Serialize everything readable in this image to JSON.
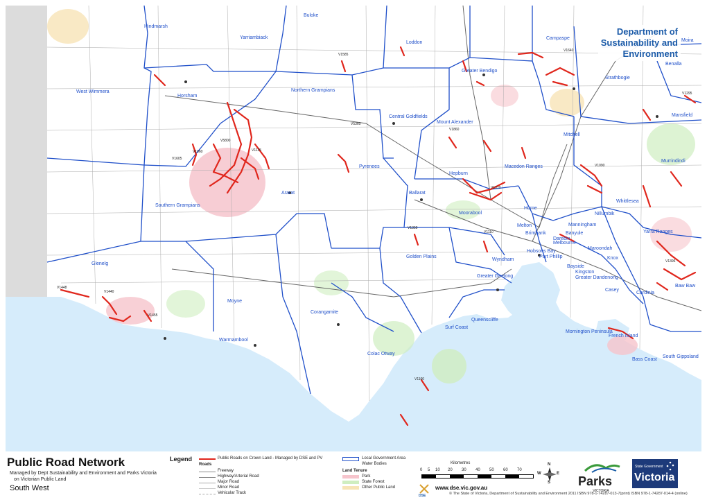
{
  "header": {
    "dept_line1": "Department of",
    "dept_line2": "Sustainability and",
    "dept_line3": "Environment"
  },
  "map": {
    "places": [
      {
        "name": "Buloke"
      },
      {
        "name": "Hindmarsh"
      },
      {
        "name": "Yarriambiack"
      },
      {
        "name": "Loddon"
      },
      {
        "name": "Campaspe"
      },
      {
        "name": "Moira"
      },
      {
        "name": "Greater Bendigo"
      },
      {
        "name": "Strathbogie"
      },
      {
        "name": "West Wimmera"
      },
      {
        "name": "Horsham"
      },
      {
        "name": "Northern Grampians"
      },
      {
        "name": "Central Goldfields"
      },
      {
        "name": "Mount Alexander"
      },
      {
        "name": "Mansfield"
      },
      {
        "name": "Mitchell"
      },
      {
        "name": "Pyrenees"
      },
      {
        "name": "Macedon Ranges"
      },
      {
        "name": "Murrindindi"
      },
      {
        "name": "Hepburn"
      },
      {
        "name": "Ararat"
      },
      {
        "name": "Ballarat"
      },
      {
        "name": "Whittlesea"
      },
      {
        "name": "Southern Grampians"
      },
      {
        "name": "Hume"
      },
      {
        "name": "Nillumbik"
      },
      {
        "name": "Moorabool"
      },
      {
        "name": "Melton"
      },
      {
        "name": "Yarra Ranges"
      },
      {
        "name": "Hobsons Bay"
      },
      {
        "name": "Melbourne"
      },
      {
        "name": "Golden Plains"
      },
      {
        "name": "Wyndham"
      },
      {
        "name": "Glenelg"
      },
      {
        "name": "Greater Geelong"
      },
      {
        "name": "Greater Dandenong"
      },
      {
        "name": "Moyne"
      },
      {
        "name": "Casey"
      },
      {
        "name": "Cardinia"
      },
      {
        "name": "Baw Baw"
      },
      {
        "name": "Corangamite"
      },
      {
        "name": "Queenscliffe"
      },
      {
        "name": "Surf Coast"
      },
      {
        "name": "Mornington Peninsula"
      },
      {
        "name": "French Island"
      },
      {
        "name": "Warrnambool"
      },
      {
        "name": "Colac Otway"
      },
      {
        "name": "Bass Coast"
      },
      {
        "name": "South Gippsland"
      },
      {
        "name": "Benalla"
      },
      {
        "name": "Port Phillip"
      },
      {
        "name": "Bayside"
      },
      {
        "name": "Kingston"
      },
      {
        "name": "Manningham"
      },
      {
        "name": "Knox"
      },
      {
        "name": "Maroondah"
      },
      {
        "name": "Banyule"
      },
      {
        "name": "Darebin"
      },
      {
        "name": "Brimbank"
      }
    ],
    "road_labels": [
      {
        "name": "V1640"
      },
      {
        "name": "V1585"
      },
      {
        "name": "V5800"
      },
      {
        "name": "V1396"
      },
      {
        "name": "V1448"
      },
      {
        "name": "V1440"
      },
      {
        "name": "V1370"
      },
      {
        "name": "V1060"
      },
      {
        "name": "V1135"
      },
      {
        "name": "V1110"
      },
      {
        "name": "V5360"
      },
      {
        "name": "V1090"
      },
      {
        "name": "V1295"
      },
      {
        "name": "V1350"
      },
      {
        "name": "V1860"
      },
      {
        "name": "V1455"
      },
      {
        "name": "V1605"
      },
      {
        "name": "V1100"
      }
    ]
  },
  "footer": {
    "title": "Public Road Network",
    "subtitle1": "Managed by Dept Sustainability and Environment and Parks Victoria",
    "subtitle2": "on Victorian Public Land",
    "region": "South West",
    "legend_title": "Legend",
    "legend_roads_heading": "Roads",
    "legend_items": {
      "crown": "Public Roads on Crown Land - Managed by DSE and PV",
      "freeway": "Freeway",
      "highway": "Highway/Arterial Road",
      "major": "Major Road",
      "minor": "Minor Road",
      "track": "Vehicular Track",
      "lga": "Local Government Area",
      "water": "Water Bodies",
      "tenure_heading": "Land Tenure",
      "park": "Park",
      "forest": "State Forest",
      "other": "Other Public Land"
    },
    "scale_title": "Kilometres",
    "scale_ticks": [
      "0",
      "5",
      "10",
      "20",
      "30",
      "40",
      "50",
      "60",
      "70"
    ],
    "north": "N",
    "west": "W",
    "east": "E",
    "south": "S",
    "website": "www.dse.vic.gov.au",
    "dse_logo": "DSE",
    "copyright": "© The State of Victoria, Department of Sustainability and Environment 2011  ISBN 978-1-74287-013-7(print)  ISBN 978-1-74287-014-4 (online)",
    "parks_logo": "Parks",
    "parks_sub": "VICTORIA",
    "vic_line1": "State Government",
    "vic_line2": "Victoria"
  },
  "colors": {
    "sea": "#d6ecfb",
    "land": "#ffffff",
    "outside": "#dcdcdc",
    "lga": "#1f4fc9",
    "crown_road": "#e0261c",
    "park": "#f6c4cc",
    "forest": "#cfeec0",
    "other": "#f7e4b6",
    "dept_blue": "#1a5aa8"
  }
}
